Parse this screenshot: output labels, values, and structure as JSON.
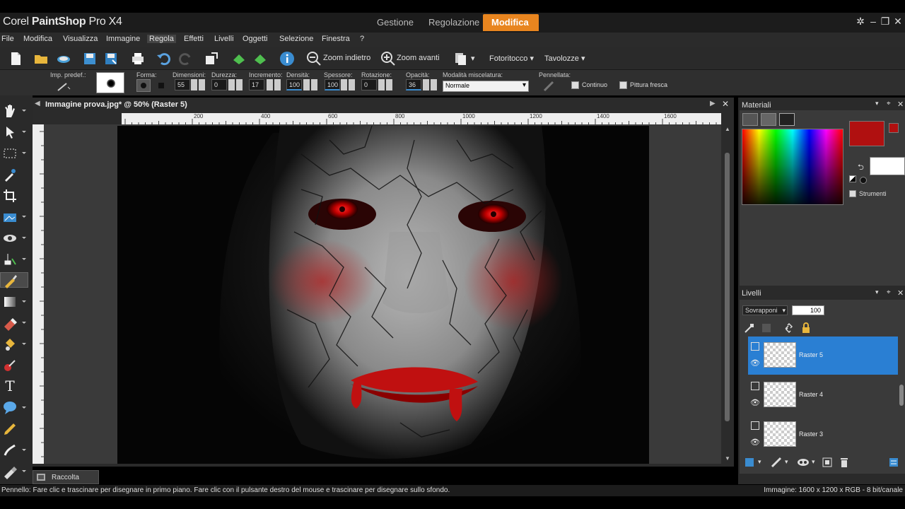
{
  "app": {
    "title_light": "Corel",
    "title_bold": "PaintShop",
    "title_suffix": "Pro X4",
    "workspace_tabs": [
      {
        "label": "Gestione",
        "active": false
      },
      {
        "label": "Regolazione",
        "active": false
      },
      {
        "label": "Modifica",
        "active": true
      }
    ],
    "accent_color": "#e8851f"
  },
  "menu": {
    "items": [
      "File",
      "Modifica",
      "Visualizza",
      "Immagine",
      "Regola",
      "Effetti",
      "Livelli",
      "Oggetti",
      "Selezione",
      "Finestra",
      "?"
    ],
    "active_index": 4
  },
  "toolbar": {
    "zoom_out_label": "Zoom indietro",
    "zoom_in_label": "Zoom avanti",
    "fotoritocco_label": "Fotoritocco",
    "tavolozze_label": "Tavolozze"
  },
  "tool_options": {
    "preset_label": "Imp. predef.:",
    "forma_label": "Forma:",
    "dimensioni_label": "Dimensioni:",
    "dimensioni_value": "55",
    "durezza_label": "Durezza:",
    "durezza_value": "0",
    "incremento_label": "Incremento:",
    "incremento_value": "17",
    "densita_label": "Densità:",
    "densita_value": "100",
    "spessore_label": "Spessore:",
    "spessore_value": "100",
    "rotazione_label": "Rotazione:",
    "rotazione_value": "0",
    "opacita_label": "Opacità:",
    "opacita_value": "36",
    "modalita_label": "Modalità miscelatura:",
    "modalita_value": "Normale",
    "pennellata_label": "Pennellata:",
    "continuo_label": "Continuo",
    "pittura_fresca_label": "Pittura fresca"
  },
  "document": {
    "title": "Immagine prova.jpg* @  50% (Raster 5)",
    "ruler_labels": [
      "200",
      "400",
      "600",
      "800",
      "1000",
      "1200",
      "1400",
      "1600"
    ]
  },
  "materials": {
    "title": "Materiali",
    "foreground_color": "#b01010",
    "background_color": "#ffffff",
    "strumenti_label": "Strumenti"
  },
  "layers": {
    "title": "Livelli",
    "blend_mode": "Sovrapponi",
    "opacity": "100",
    "items": [
      {
        "name": "Raster 5",
        "selected": true
      },
      {
        "name": "Raster 4",
        "selected": false
      },
      {
        "name": "Raster 3",
        "selected": false
      }
    ]
  },
  "raccolta_label": "Raccolta",
  "status": {
    "left": "Pennello: Fare clic e trascinare per disegnare in primo piano. Fare clic con il pulsante destro del mouse e trascinare per disegnare sullo sfondo.",
    "right": "Immagine:  1600 x 1200 x RGB - 8 bit/canale"
  }
}
